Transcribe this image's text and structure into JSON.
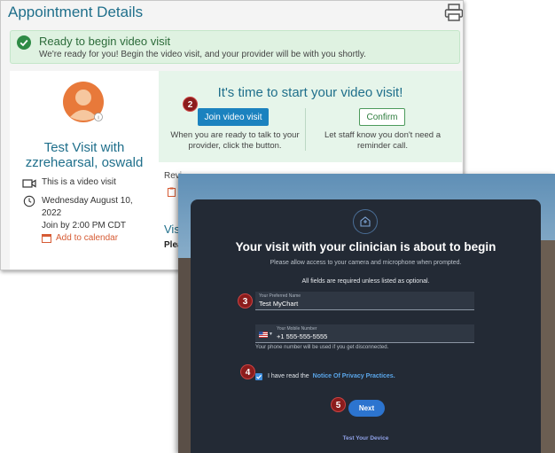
{
  "appointment": {
    "title": "Appointment Details",
    "print_icon": "printer-icon",
    "banner": {
      "title": "Ready to begin video visit",
      "subtitle": "We're ready for you! Begin the video visit, and your provider will be with you shortly.",
      "icon": "check-circle-icon",
      "color": "#dff2e1"
    },
    "visit": {
      "title": "Test Visit with zzrehearsal, oswald",
      "type_text": "This is a video visit",
      "date": "Wednesday August 10, 2022",
      "join_by": "Join by 2:00 PM CDT",
      "add_calendar": "Add to calendar"
    },
    "start": {
      "heading": "It's time to start your video visit!",
      "join_label": "Join video visit",
      "join_desc": "When you are ready to talk to your provider, click the button.",
      "confirm_label": "Confirm",
      "confirm_desc": "Let staff know you don't need a reminder call."
    },
    "lower": {
      "review": "Revi",
      "visit_heading": "Visi",
      "please": "Plea"
    }
  },
  "steps": {
    "s2": "2",
    "s3": "3",
    "s4": "4",
    "s5": "5"
  },
  "video_dialog": {
    "title": "Your visit with your clinician is about to begin",
    "subtitle": "Please allow access to your camera and microphone when prompted.",
    "required_note": "All fields are required unless listed as optional.",
    "name_field": {
      "label": "Your Preferred Name",
      "value": "Test MyChart"
    },
    "phone_field": {
      "label": "Your Mobile Number",
      "value": "+1 555-555-5555",
      "hint": "Your phone number will be used if you get disconnected."
    },
    "privacy_text": "I have read the",
    "privacy_link": "Notice Of Privacy Practices.",
    "privacy_checked": true,
    "next_label": "Next",
    "test_device": "Test Your Device"
  },
  "colors": {
    "accent_blue": "#1b82bf",
    "title_teal": "#1f6f8b",
    "dialog_bg": "#232a35",
    "step_badge": "#8b1c1c"
  }
}
